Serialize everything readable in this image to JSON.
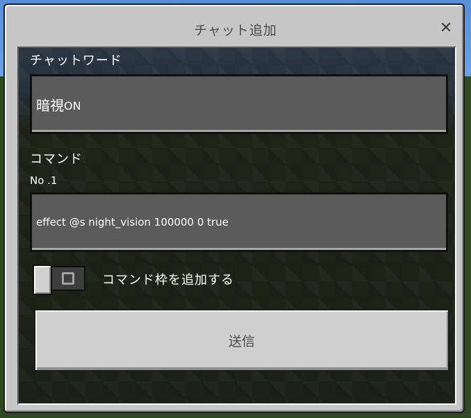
{
  "dialog": {
    "title": "チャット追加",
    "close_icon": "close-icon"
  },
  "chat_word": {
    "label": "チャットワード",
    "value_kanji": "暗視",
    "value_suffix": "ON"
  },
  "command": {
    "label": "コマンド",
    "number": "No .1",
    "value": "effect @s night_vision 100000 0 true"
  },
  "add_frame": {
    "label": "コマンド枠を追加する",
    "enabled": false
  },
  "send_button": {
    "label": "送信"
  }
}
